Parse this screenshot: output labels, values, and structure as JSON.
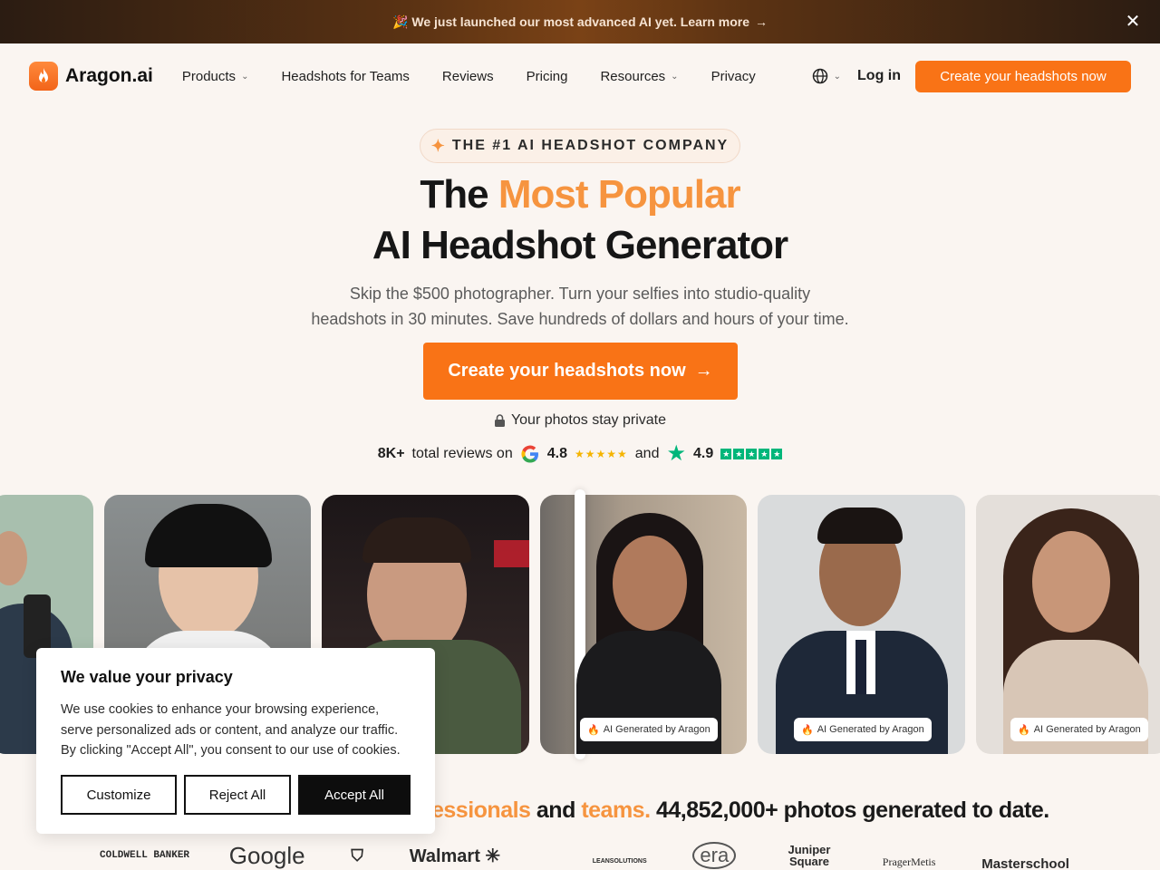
{
  "banner": {
    "emoji": "🎉",
    "text": "We just launched our most advanced AI yet. Learn more",
    "arrow": "→",
    "close_icon": "close-icon"
  },
  "nav": {
    "logo_text": "Aragon.ai",
    "items": [
      {
        "label": "Products",
        "dropdown": true
      },
      {
        "label": "Headshots for Teams",
        "dropdown": false
      },
      {
        "label": "Reviews",
        "dropdown": false
      },
      {
        "label": "Pricing",
        "dropdown": false
      },
      {
        "label": "Resources",
        "dropdown": true
      },
      {
        "label": "Privacy",
        "dropdown": false
      }
    ],
    "login": "Log in",
    "cta": "Create your headshots now"
  },
  "hero": {
    "pill": "THE #1 AI HEADSHOT COMPANY",
    "title_part1": "The",
    "title_accent": "Most Popular",
    "title_line2": "AI Headshot Generator",
    "subtitle_line1": "Skip the $500 photographer. Turn your selfies into studio-quality",
    "subtitle_line2": "headshots in 30 minutes. Save hundreds of dollars and hours of your time.",
    "cta": "Create your headshots now",
    "private_note": "Your photos stay private",
    "reviews_count": "8K+",
    "reviews_text": "total reviews on",
    "google_rating": "4.8",
    "and": "and",
    "trustpilot_rating": "4.9"
  },
  "photos": {
    "badge": "AI Generated by Aragon"
  },
  "stats": {
    "accent1": "essionals",
    "and": "and",
    "accent2": "teams.",
    "count_text": "44,852,000+ photos generated to date."
  },
  "logos": [
    "COLDWELL BANKER",
    "Google",
    "Walmart",
    "LEANSOLUTIONS",
    "era",
    "Juniper Square",
    "PragerMetis",
    "Masterschool"
  ],
  "cookie": {
    "title": "We value your privacy",
    "body": "We use cookies to enhance your browsing experience, serve personalized ads or content, and analyze our traffic. By clicking \"Accept All\", you consent to our use of cookies.",
    "customize": "Customize",
    "reject": "Reject All",
    "accept": "Accept All"
  },
  "colors": {
    "accent": "#f97316",
    "accent_text": "#f6943f",
    "banner_bg": "#5a3213"
  }
}
